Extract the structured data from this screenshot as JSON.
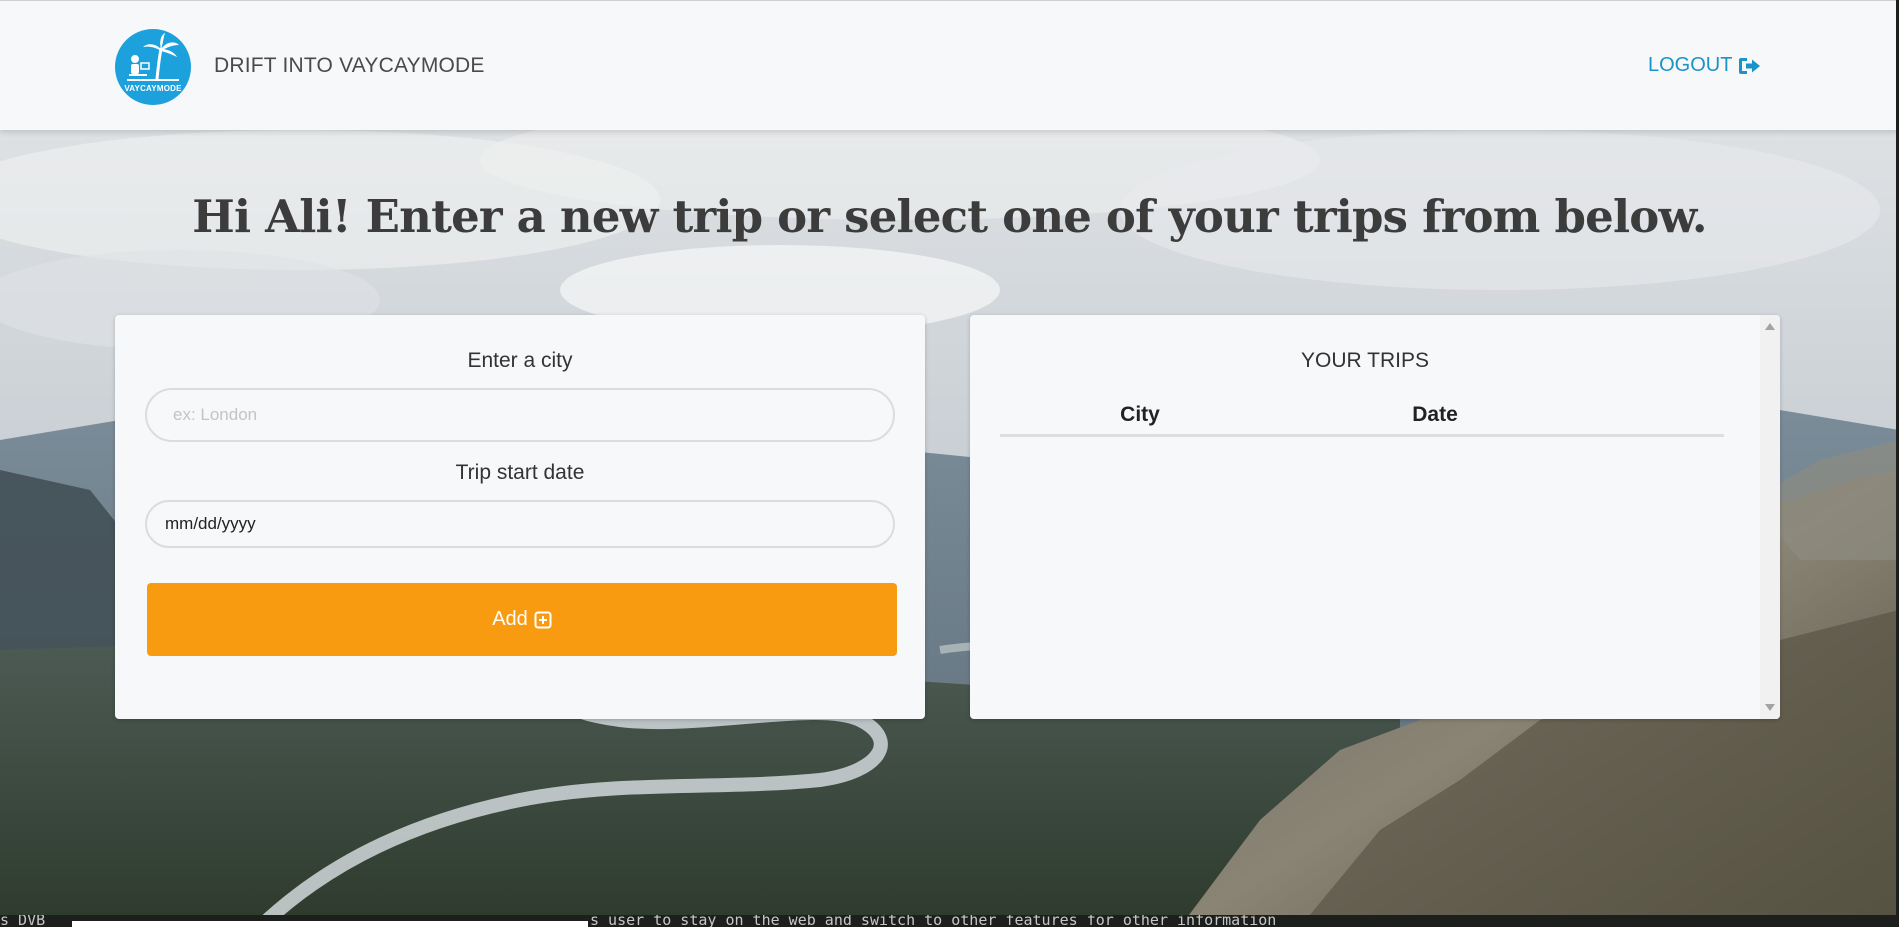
{
  "header": {
    "brand": "DRIFT INTO VAYCAYMODE",
    "logo_text": "VAYCAYMODE",
    "logout_label": "LOGOUT",
    "logout_icon": "sign-out-icon"
  },
  "main": {
    "headline": "Hi Ali! Enter a new trip or select one of your trips from below."
  },
  "trip_form": {
    "city_label": "Enter a city",
    "city_placeholder": "ex: London",
    "city_value": "",
    "date_label": "Trip start date",
    "date_value": "mm/dd/yyyy",
    "add_label": "Add",
    "add_icon": "plus-square-icon"
  },
  "trips": {
    "title": "YOUR TRIPS",
    "columns": [
      "City",
      "Date"
    ],
    "rows": []
  },
  "bottom_strip": {
    "left_text": "s DVB",
    "right_text": "s user to stay on the web      and switch to other features for other information"
  },
  "colors": {
    "accent_blue": "#1c93c8",
    "button_orange": "#f99b11",
    "logo_blue": "#1da1dc",
    "card_bg": "#f7f8fa"
  }
}
